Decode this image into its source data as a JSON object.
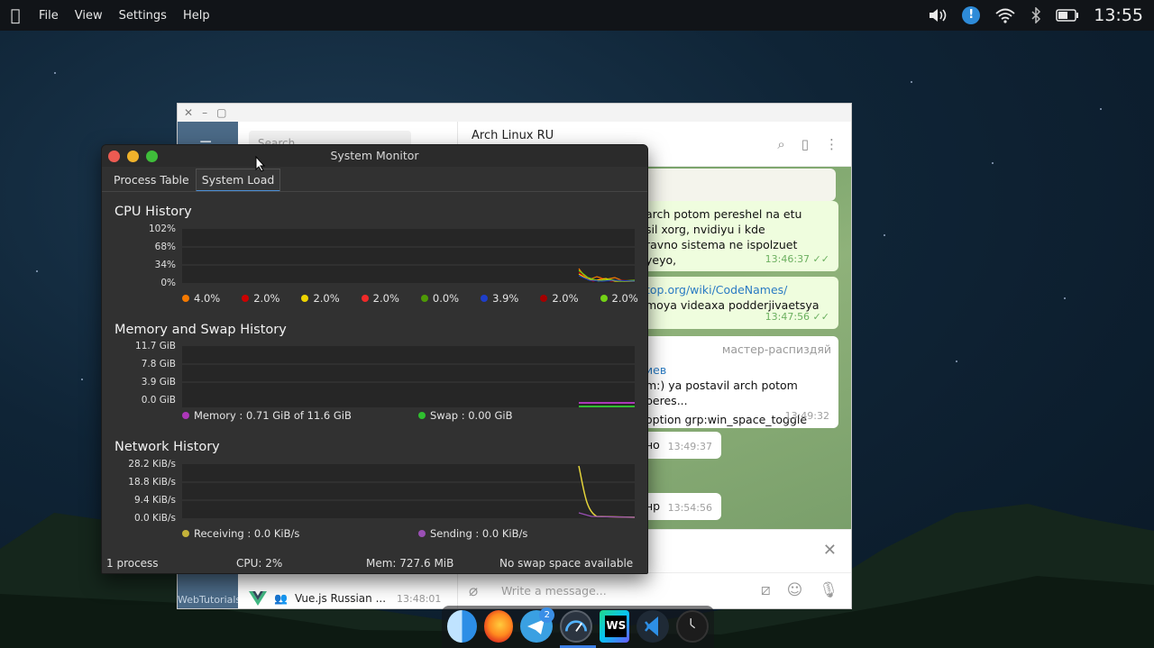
{
  "menubar": {
    "items": [
      "File",
      "View",
      "Settings",
      "Help"
    ],
    "clock": "13:55"
  },
  "telegram": {
    "search_placeholder": "Search",
    "chat_title": "Arch Linux RU",
    "sidebar_label": "WebTutorials",
    "last_chat": {
      "name": "Vue.js Russian ...",
      "time": "13:48:01"
    },
    "messages": [
      {
        "lines": [
          "arch potom pereshel na etu",
          "sil xorg, nvidiyu i kde",
          "ravno sistema ne ispolzuet yeyo,"
        ],
        "time": "13:46:37"
      },
      {
        "link": "top.org/wiki/CodeNames/",
        "line": "moya videaxa podderjivaetsya",
        "time": "13:47:56"
      },
      {
        "sender": "мастер-распиздяй",
        "author": "иев",
        "lines": [
          "m:) ya postavil arch potom peres...",
          "option grp:win_space_toggle"
        ],
        "time": "13:49:32"
      },
      {
        "text": "но",
        "time": "13:49:37"
      },
      {
        "text": "нр",
        "time": "13:54:56"
      }
    ],
    "input_placeholder": "Write a message..."
  },
  "sysmon": {
    "title": "System Monitor",
    "tabs": [
      "Process Table",
      "System Load"
    ],
    "active_tab": "System Load",
    "cpu": {
      "title": "CPU History",
      "yticks": [
        "102%",
        "68%",
        "34%",
        "0%"
      ],
      "legend": [
        {
          "value": "4.0%",
          "color": "#f57900"
        },
        {
          "value": "2.0%",
          "color": "#cc0000"
        },
        {
          "value": "2.0%",
          "color": "#edd400"
        },
        {
          "value": "2.0%",
          "color": "#ef2929"
        },
        {
          "value": "0.0%",
          "color": "#4e9a06"
        },
        {
          "value": "3.9%",
          "color": "#1e3ec9"
        },
        {
          "value": "2.0%",
          "color": "#a40000"
        },
        {
          "value": "2.0%",
          "color": "#73d216"
        }
      ]
    },
    "memory": {
      "title": "Memory and Swap History",
      "yticks": [
        "11.7 GiB",
        "7.8 GiB",
        "3.9 GiB",
        "0.0 GiB"
      ],
      "memory_label": "Memory : 0.71 GiB of 11.6 GiB",
      "swap_label": "Swap : 0.00 GiB",
      "memory_color": "#ad37b9",
      "swap_color": "#2fbf2f"
    },
    "network": {
      "title": "Network History",
      "yticks": [
        "28.2 KiB/s",
        "18.8 KiB/s",
        "9.4 KiB/s",
        "0.0 KiB/s"
      ],
      "receiving_label": "Receiving : 0.0 KiB/s",
      "sending_label": "Sending : 0.0 KiB/s",
      "receiving_color": "#c4b23a",
      "sending_color": "#9a4fb5"
    },
    "status": {
      "processes": "1 process",
      "cpu": "CPU: 2%",
      "mem": "Mem: 727.6 MiB",
      "swap": "No swap space available"
    }
  },
  "dock": {
    "apps": [
      "finder-icon",
      "firefox-icon",
      "telegram-icon",
      "system-monitor-icon",
      "webstorm-icon",
      "vscode-icon",
      "clock-icon"
    ],
    "telegram_badge": "2",
    "webstorm_label": "WS"
  }
}
